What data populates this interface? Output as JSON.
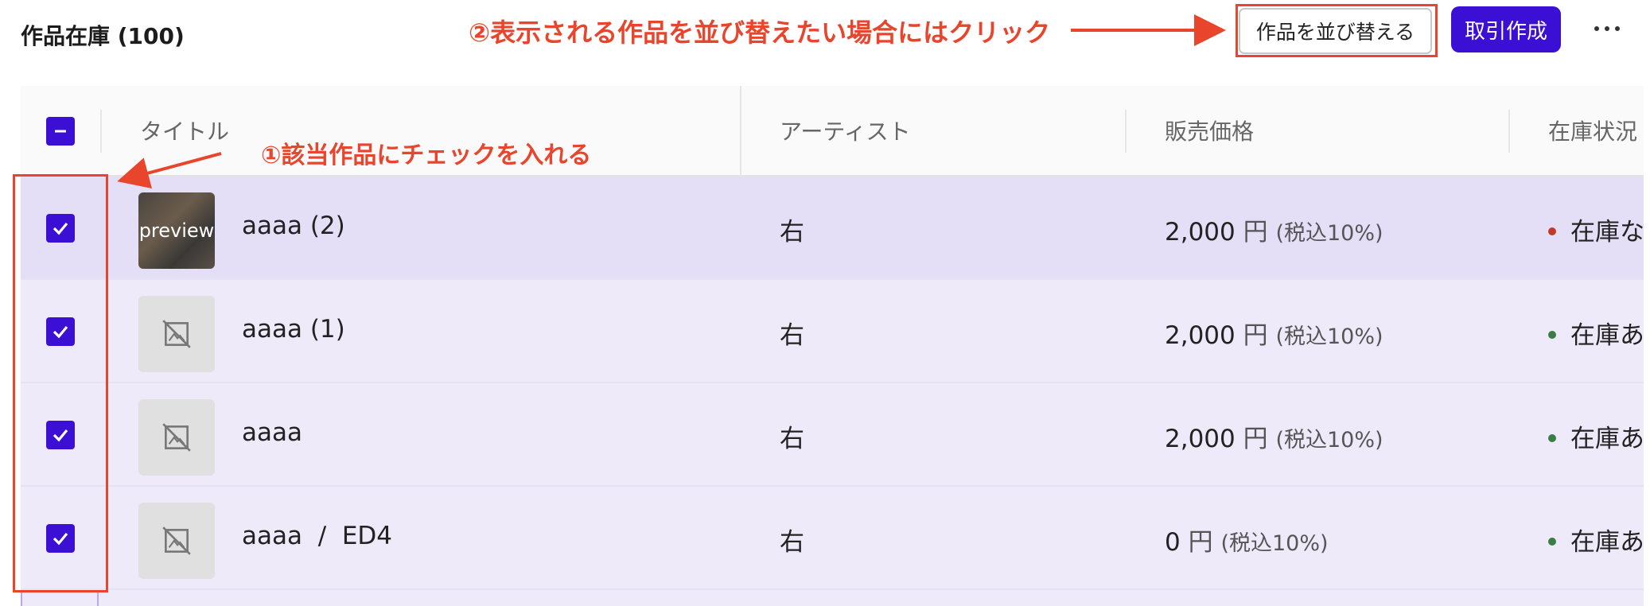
{
  "header": {
    "title": "作品在庫 (100)",
    "reorder_button": "作品を並び替える",
    "create_button": "取引作成"
  },
  "table": {
    "columns": [
      "タイトル",
      "アーティスト",
      "販売価格",
      "在庫状況"
    ],
    "rows": [
      {
        "title": "aaaa (2)",
        "thumb_label": "preview",
        "artist": "右",
        "price": "2,000",
        "yen": "円",
        "tax": "(税込10%)",
        "status": "在庫な",
        "status_color": "#c0392b"
      },
      {
        "title": "aaaa (1)",
        "artist": "右",
        "price": "2,000",
        "yen": "円",
        "tax": "(税込10%)",
        "status": "在庫あ",
        "status_color": "#3a7d44"
      },
      {
        "title": "aaaa",
        "artist": "右",
        "price": "2,000",
        "yen": "円",
        "tax": "(税込10%)",
        "status": "在庫あ",
        "status_color": "#3a7d44"
      },
      {
        "title": "aaaa  /  ED4",
        "artist": "右",
        "price": "0",
        "yen": "円",
        "tax": "(税込10%)",
        "status": "在庫あ",
        "status_color": "#3a7d44"
      }
    ]
  },
  "annotations": {
    "step1": "①該当作品にチェックを入れる",
    "step2": "②表示される作品を並び替えたい場合にはクリック"
  },
  "colors": {
    "accent": "#3c10d4",
    "annotation": "#e8452c",
    "row_selected_bg": "#efeafa"
  }
}
